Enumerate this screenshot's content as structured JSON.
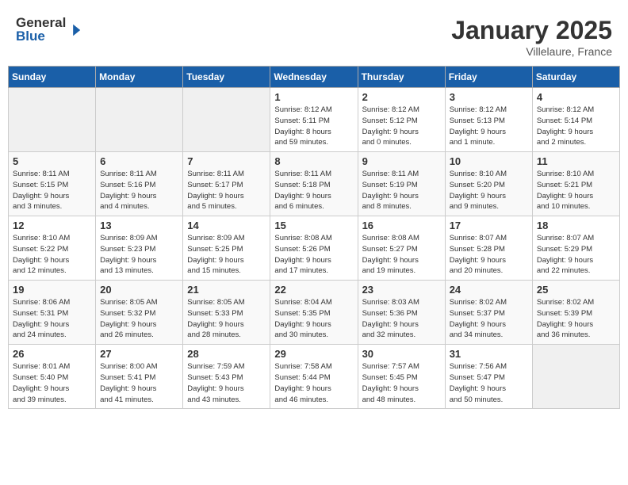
{
  "header": {
    "logo_general": "General",
    "logo_blue": "Blue",
    "month_title": "January 2025",
    "location": "Villelaure, France"
  },
  "days_of_week": [
    "Sunday",
    "Monday",
    "Tuesday",
    "Wednesday",
    "Thursday",
    "Friday",
    "Saturday"
  ],
  "weeks": [
    [
      {
        "day": "",
        "info": ""
      },
      {
        "day": "",
        "info": ""
      },
      {
        "day": "",
        "info": ""
      },
      {
        "day": "1",
        "info": "Sunrise: 8:12 AM\nSunset: 5:11 PM\nDaylight: 8 hours\nand 59 minutes."
      },
      {
        "day": "2",
        "info": "Sunrise: 8:12 AM\nSunset: 5:12 PM\nDaylight: 9 hours\nand 0 minutes."
      },
      {
        "day": "3",
        "info": "Sunrise: 8:12 AM\nSunset: 5:13 PM\nDaylight: 9 hours\nand 1 minute."
      },
      {
        "day": "4",
        "info": "Sunrise: 8:12 AM\nSunset: 5:14 PM\nDaylight: 9 hours\nand 2 minutes."
      }
    ],
    [
      {
        "day": "5",
        "info": "Sunrise: 8:11 AM\nSunset: 5:15 PM\nDaylight: 9 hours\nand 3 minutes."
      },
      {
        "day": "6",
        "info": "Sunrise: 8:11 AM\nSunset: 5:16 PM\nDaylight: 9 hours\nand 4 minutes."
      },
      {
        "day": "7",
        "info": "Sunrise: 8:11 AM\nSunset: 5:17 PM\nDaylight: 9 hours\nand 5 minutes."
      },
      {
        "day": "8",
        "info": "Sunrise: 8:11 AM\nSunset: 5:18 PM\nDaylight: 9 hours\nand 6 minutes."
      },
      {
        "day": "9",
        "info": "Sunrise: 8:11 AM\nSunset: 5:19 PM\nDaylight: 9 hours\nand 8 minutes."
      },
      {
        "day": "10",
        "info": "Sunrise: 8:10 AM\nSunset: 5:20 PM\nDaylight: 9 hours\nand 9 minutes."
      },
      {
        "day": "11",
        "info": "Sunrise: 8:10 AM\nSunset: 5:21 PM\nDaylight: 9 hours\nand 10 minutes."
      }
    ],
    [
      {
        "day": "12",
        "info": "Sunrise: 8:10 AM\nSunset: 5:22 PM\nDaylight: 9 hours\nand 12 minutes."
      },
      {
        "day": "13",
        "info": "Sunrise: 8:09 AM\nSunset: 5:23 PM\nDaylight: 9 hours\nand 13 minutes."
      },
      {
        "day": "14",
        "info": "Sunrise: 8:09 AM\nSunset: 5:25 PM\nDaylight: 9 hours\nand 15 minutes."
      },
      {
        "day": "15",
        "info": "Sunrise: 8:08 AM\nSunset: 5:26 PM\nDaylight: 9 hours\nand 17 minutes."
      },
      {
        "day": "16",
        "info": "Sunrise: 8:08 AM\nSunset: 5:27 PM\nDaylight: 9 hours\nand 19 minutes."
      },
      {
        "day": "17",
        "info": "Sunrise: 8:07 AM\nSunset: 5:28 PM\nDaylight: 9 hours\nand 20 minutes."
      },
      {
        "day": "18",
        "info": "Sunrise: 8:07 AM\nSunset: 5:29 PM\nDaylight: 9 hours\nand 22 minutes."
      }
    ],
    [
      {
        "day": "19",
        "info": "Sunrise: 8:06 AM\nSunset: 5:31 PM\nDaylight: 9 hours\nand 24 minutes."
      },
      {
        "day": "20",
        "info": "Sunrise: 8:05 AM\nSunset: 5:32 PM\nDaylight: 9 hours\nand 26 minutes."
      },
      {
        "day": "21",
        "info": "Sunrise: 8:05 AM\nSunset: 5:33 PM\nDaylight: 9 hours\nand 28 minutes."
      },
      {
        "day": "22",
        "info": "Sunrise: 8:04 AM\nSunset: 5:35 PM\nDaylight: 9 hours\nand 30 minutes."
      },
      {
        "day": "23",
        "info": "Sunrise: 8:03 AM\nSunset: 5:36 PM\nDaylight: 9 hours\nand 32 minutes."
      },
      {
        "day": "24",
        "info": "Sunrise: 8:02 AM\nSunset: 5:37 PM\nDaylight: 9 hours\nand 34 minutes."
      },
      {
        "day": "25",
        "info": "Sunrise: 8:02 AM\nSunset: 5:39 PM\nDaylight: 9 hours\nand 36 minutes."
      }
    ],
    [
      {
        "day": "26",
        "info": "Sunrise: 8:01 AM\nSunset: 5:40 PM\nDaylight: 9 hours\nand 39 minutes."
      },
      {
        "day": "27",
        "info": "Sunrise: 8:00 AM\nSunset: 5:41 PM\nDaylight: 9 hours\nand 41 minutes."
      },
      {
        "day": "28",
        "info": "Sunrise: 7:59 AM\nSunset: 5:43 PM\nDaylight: 9 hours\nand 43 minutes."
      },
      {
        "day": "29",
        "info": "Sunrise: 7:58 AM\nSunset: 5:44 PM\nDaylight: 9 hours\nand 46 minutes."
      },
      {
        "day": "30",
        "info": "Sunrise: 7:57 AM\nSunset: 5:45 PM\nDaylight: 9 hours\nand 48 minutes."
      },
      {
        "day": "31",
        "info": "Sunrise: 7:56 AM\nSunset: 5:47 PM\nDaylight: 9 hours\nand 50 minutes."
      },
      {
        "day": "",
        "info": ""
      }
    ]
  ]
}
